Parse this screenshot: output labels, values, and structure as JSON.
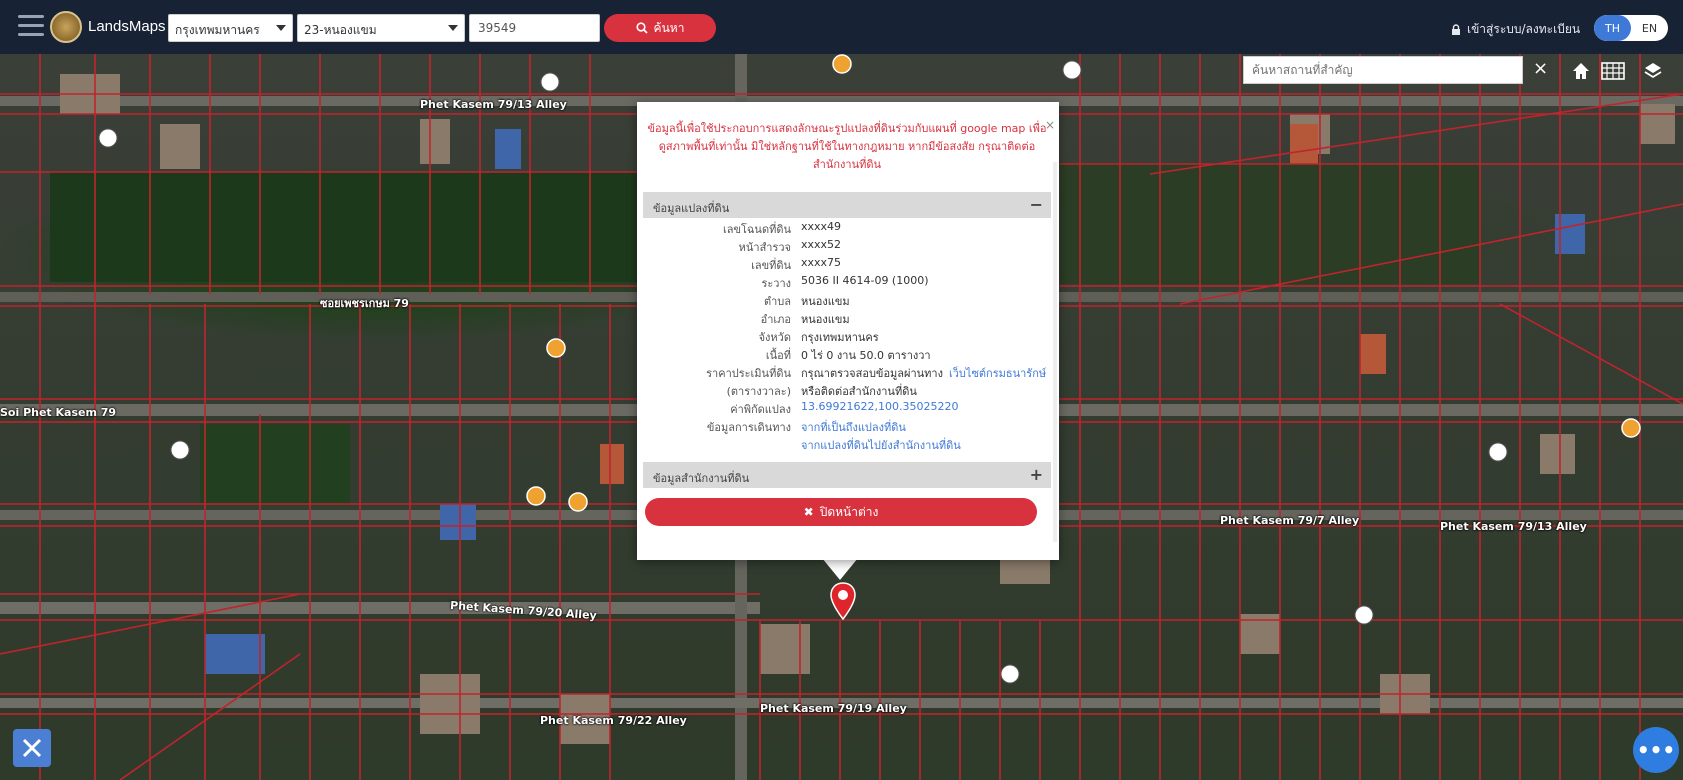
{
  "topbar": {
    "brand": "LandsMaps",
    "province": "กรุงเทพมหานคร",
    "district": "23-หนองแขม",
    "parcel_value": "39549",
    "search_label": "ค้นหา",
    "login_label": "เข้าสู่ระบบ/ลงทะเบียน",
    "lang_th": "TH",
    "lang_en": "EN"
  },
  "map": {
    "search_placeholder": "ค้นหาสถานที่สำคัญ",
    "close": "×",
    "roads": [
      "Phet Kasem 79/13 Alley",
      "ซอยเพชรเกษม 79",
      "Phet Kasem 79/20 Alley",
      "Phet Kasem 79/7 Alley",
      "Phet Kasem 79/13 Alley",
      "Phet Kasem 79/22 Alley",
      "Phet Kasem 79/19 Alley",
      "Soi Phet Kasem 79"
    ]
  },
  "popup": {
    "notice": "ข้อมูลนี้เพื่อใช้ประกอบการแสดงลักษณะรูปแปลงที่ดินร่วมกับแผนที่ google map เพื่อดูสภาพพื้นที่เท่านั้น มิใช่หลักฐานที่ใช้ในทางกฎหมาย หากมีข้อสงสัย กรุณาติดต่อสำนักงานที่ดิน",
    "close": "×",
    "section_parcel": "ข้อมูลแปลงที่ดิน",
    "section_office": "ข้อมูลสำนักงานที่ดิน",
    "minus": "−",
    "plus": "+",
    "rows": [
      {
        "k": "เลขโฉนดที่ดิน",
        "v": "xxxx49"
      },
      {
        "k": "หน้าสำรวจ",
        "v": "xxxx52"
      },
      {
        "k": "เลขที่ดิน",
        "v": "xxxx75"
      },
      {
        "k": "ระวาง",
        "v": "5036 II 4614-09 (1000)"
      },
      {
        "k": "ตำบล",
        "v": "หนองแขม"
      },
      {
        "k": "อำเภอ",
        "v": "หนองแขม"
      },
      {
        "k": "จังหวัด",
        "v": "กรุงเทพมหานคร"
      },
      {
        "k": "เนื้อที่",
        "v": "0 ไร่ 0 งาน 50.0 ตารางวา"
      },
      {
        "k": "ราคาประเมินที่ดิน",
        "v": "กรุณาตรวจสอบข้อมูลผ่านทาง",
        "link": "เว็บไซต์กรมธนารักษ์"
      },
      {
        "k": "(ตารางวาละ)",
        "v": "หรือติดต่อสำนักงานที่ดิน"
      },
      {
        "k": "ค่าพิกัดแปลง",
        "v": "",
        "link": "13.69921622,100.35025220"
      },
      {
        "k": "ข้อมูลการเดินทาง",
        "v": "",
        "link": "จากที่เป็นถึงแปลงที่ดิน"
      },
      {
        "k": "",
        "v": "",
        "link": "จากแปลงที่ดินไปยังสำนักงานที่ดิน"
      }
    ],
    "back_label": "ปิดหน้าต่าง"
  },
  "fab_label": "•••",
  "colors": {
    "topbar_bg": "#182235",
    "accent_red": "#d9323f",
    "accent_blue": "#3f79d8",
    "parcel_line": "#c0242c"
  }
}
